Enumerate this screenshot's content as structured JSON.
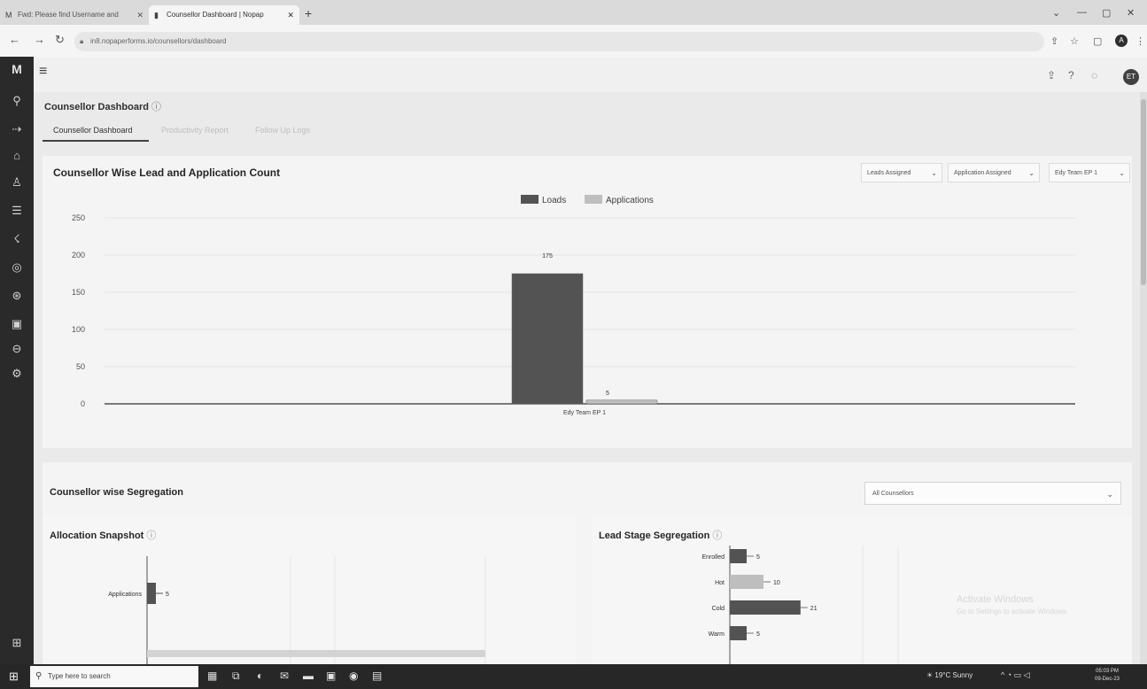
{
  "browser": {
    "tabs": [
      {
        "title": "Fwd: Please find Username and",
        "icon": "gmail-icon"
      },
      {
        "title": "Counsellor Dashboard | Nopap",
        "icon": "app-icon"
      }
    ],
    "url": "in8.nopaperforms.io/counsellors/dashboard"
  },
  "page": {
    "title": "Counsellor Dashboard",
    "tabs": [
      "Counsellor Dashboard",
      "Productivity Report",
      "Follow Up Logs"
    ]
  },
  "lead_chart": {
    "title": "Counsellor Wise Lead and Application Count",
    "dropdowns": [
      "Leads Assigned",
      "Application Assigned",
      "Edy Team EP 1"
    ]
  },
  "segregation": {
    "title": "Counsellor wise Segregation",
    "selector_value": "All Counsellors",
    "allocation_title": "Allocation Snapshot",
    "lead_stage_title": "Lead Stage Segregation"
  },
  "watermark": {
    "line1": "Activate Windows",
    "line2": "Go to Settings to activate Windows."
  },
  "taskbar": {
    "search_placeholder": "Type here to search",
    "weather": "19°C Sunny",
    "time": "05:03 PM",
    "date": "09-Dec-23"
  },
  "header": {
    "avatar_initials": "ET"
  },
  "chart_data": [
    {
      "type": "bar",
      "categories": [
        "Edy Team EP 1"
      ],
      "series": [
        {
          "name": "Loads",
          "values": [
            175
          ],
          "color": "#555555"
        },
        {
          "name": "Applications",
          "values": [
            5
          ],
          "color": "#bbbbbb"
        }
      ],
      "ylim": [
        0,
        250
      ],
      "yticks": [
        0,
        50,
        100,
        150,
        200,
        250
      ],
      "legend": "top-center"
    },
    {
      "type": "bar",
      "orientation": "horizontal",
      "categories": [
        "Applications"
      ],
      "values": [
        5
      ]
    },
    {
      "type": "bar",
      "orientation": "horizontal",
      "categories": [
        "Enrolled",
        "Hot",
        "Cold",
        "Warm"
      ],
      "values": [
        5,
        10,
        21,
        5
      ]
    }
  ]
}
